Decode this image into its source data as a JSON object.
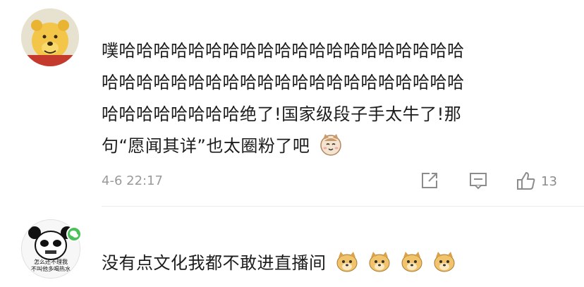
{
  "comments": [
    {
      "line1": "噗哈哈哈哈哈哈哈哈哈哈哈哈哈哈哈哈哈哈哈哈",
      "line2": "哈哈哈哈哈哈哈哈哈哈哈哈哈哈哈哈哈哈哈哈哈",
      "line3": "哈哈哈哈哈哈哈哈绝了!国家级段子手太牛了!那",
      "line4": "句“愿闻其详”也太圈粉了吧",
      "emoji": "cat-face-emoji",
      "time": "4-6 22:17",
      "like_count": "13"
    },
    {
      "text": "没有点文化我都不敢进直播间",
      "emojis": [
        "doge-emoji",
        "doge-emoji",
        "doge-emoji",
        "doge-emoji"
      ],
      "avatar_caption_line1": "怎么还不理我",
      "avatar_caption_line2": "不叫他多喝热水"
    }
  ],
  "colors": {
    "meta": "#9a9a9a",
    "wechat": "#4ac15a"
  }
}
